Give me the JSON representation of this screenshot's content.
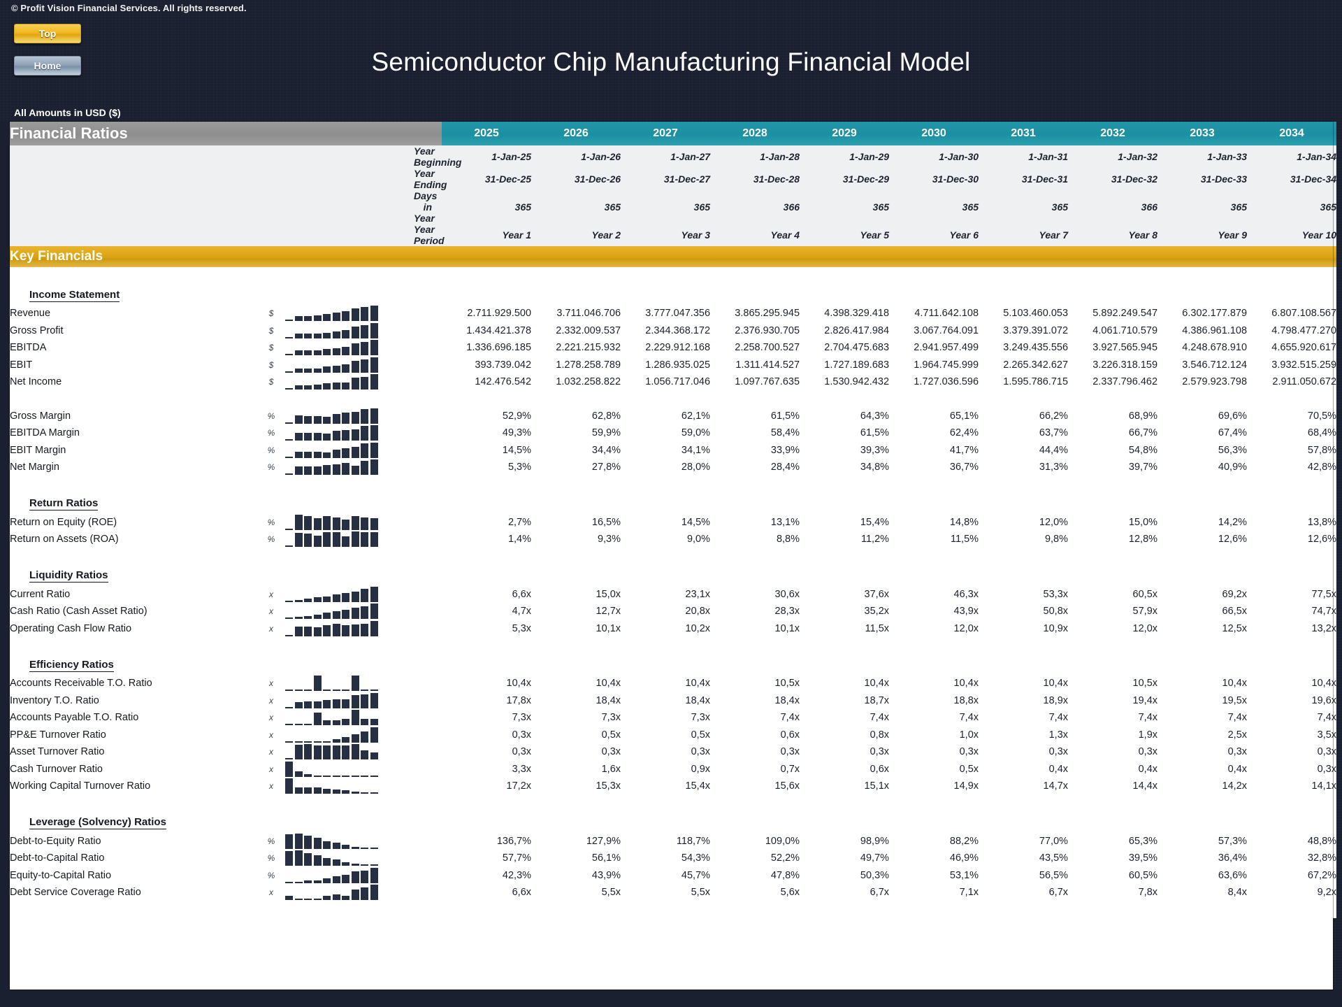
{
  "topbar": {
    "copyright": "© Profit Vision Financial Services. All rights reserved.",
    "top_button": "Top",
    "home_button": "Home"
  },
  "header": {
    "title": "Semiconductor Chip Manufacturing Financial Model",
    "units_note": "All Amounts in  USD ($)"
  },
  "table": {
    "title": "Financial Ratios",
    "section_banner": "Key Financials",
    "years": [
      "2025",
      "2026",
      "2027",
      "2028",
      "2029",
      "2030",
      "2031",
      "2032",
      "2033",
      "2034"
    ],
    "meta_rows": [
      {
        "label": "Year Beginning",
        "values": [
          "1-Jan-25",
          "1-Jan-26",
          "1-Jan-27",
          "1-Jan-28",
          "1-Jan-29",
          "1-Jan-30",
          "1-Jan-31",
          "1-Jan-32",
          "1-Jan-33",
          "1-Jan-34"
        ]
      },
      {
        "label": "Year Ending",
        "values": [
          "31-Dec-25",
          "31-Dec-26",
          "31-Dec-27",
          "31-Dec-28",
          "31-Dec-29",
          "31-Dec-30",
          "31-Dec-31",
          "31-Dec-32",
          "31-Dec-33",
          "31-Dec-34"
        ]
      },
      {
        "label": "Days in Year",
        "values": [
          "365",
          "365",
          "365",
          "366",
          "365",
          "365",
          "365",
          "366",
          "365",
          "365"
        ]
      },
      {
        "label": "Year Period",
        "values": [
          "Year 1",
          "Year 2",
          "Year 3",
          "Year 4",
          "Year 5",
          "Year 6",
          "Year 7",
          "Year 8",
          "Year 9",
          "Year 10"
        ]
      }
    ],
    "sections": [
      {
        "name": "Income Statement",
        "rows": [
          {
            "label": "Revenue",
            "unit": "$",
            "spark": [
              2,
              11,
              11,
              13,
              16,
              20,
              23,
              30,
              33,
              36
            ],
            "values": [
              "2.711.929.500",
              "3.711.046.706",
              "3.777.047.356",
              "3.865.295.945",
              "4.398.329.418",
              "4.711.642.108",
              "5.103.460.053",
              "5.892.249.547",
              "6.302.177.879",
              "6.807.108.567"
            ]
          },
          {
            "label": "Gross Profit",
            "unit": "$",
            "spark": [
              2,
              11,
              11,
              11,
              13,
              16,
              20,
              28,
              31,
              36
            ],
            "values": [
              "1.434.421.378",
              "2.332.009.537",
              "2.344.368.172",
              "2.376.930.705",
              "2.826.417.984",
              "3.067.764.091",
              "3.379.391.072",
              "4.061.710.579",
              "4.386.961.108",
              "4.798.477.270"
            ]
          },
          {
            "label": "EBITDA",
            "unit": "$",
            "spark": [
              2,
              11,
              11,
              11,
              14,
              16,
              20,
              28,
              31,
              36
            ],
            "values": [
              "1.336.696.185",
              "2.221.215.932",
              "2.229.912.168",
              "2.258.700.527",
              "2.704.475.683",
              "2.941.957.499",
              "3.249.435.556",
              "3.927.565.945",
              "4.248.678.910",
              "4.655.920.617"
            ]
          },
          {
            "label": "EBIT",
            "unit": "$",
            "spark": [
              2,
              9,
              9,
              10,
              14,
              16,
              19,
              28,
              31,
              36
            ],
            "values": [
              "393.739.042",
              "1.278.258.789",
              "1.286.935.025",
              "1.311.414.527",
              "1.727.189.683",
              "1.964.745.999",
              "2.265.342.627",
              "3.226.318.159",
              "3.546.712.124",
              "3.932.515.259"
            ]
          },
          {
            "label": "Net Income",
            "unit": "$",
            "spark": [
              2,
              10,
              10,
              11,
              15,
              17,
              16,
              27,
              30,
              36
            ],
            "values": [
              "142.476.542",
              "1.032.258.822",
              "1.056.717.046",
              "1.097.767.635",
              "1.530.942.432",
              "1.727.036.596",
              "1.595.786.715",
              "2.337.796.462",
              "2.579.923.798",
              "2.911.050.672"
            ]
          }
        ]
      },
      {
        "name": "",
        "rows": [
          {
            "label": "Gross Margin",
            "unit": "%",
            "spark": [
              2,
              18,
              17,
              17,
              16,
              22,
              24,
              26,
              32,
              34
            ],
            "values": [
              "52,9%",
              "62,8%",
              "62,1%",
              "61,5%",
              "64,3%",
              "65,1%",
              "66,2%",
              "68,9%",
              "69,6%",
              "70,5%"
            ]
          },
          {
            "label": "EBITDA Margin",
            "unit": "%",
            "spark": [
              2,
              17,
              17,
              17,
              16,
              21,
              23,
              25,
              32,
              34
            ],
            "values": [
              "49,3%",
              "59,9%",
              "59,0%",
              "58,4%",
              "61,5%",
              "62,4%",
              "63,7%",
              "66,7%",
              "67,4%",
              "68,4%"
            ]
          },
          {
            "label": "EBIT Margin",
            "unit": "%",
            "spark": [
              2,
              14,
              14,
              14,
              13,
              19,
              22,
              24,
              32,
              34
            ],
            "values": [
              "14,5%",
              "34,4%",
              "34,1%",
              "33,9%",
              "39,3%",
              "41,7%",
              "44,4%",
              "54,8%",
              "56,3%",
              "57,8%"
            ]
          },
          {
            "label": "Net Margin",
            "unit": "%",
            "spark": [
              2,
              17,
              17,
              17,
              21,
              22,
              25,
              19,
              29,
              32
            ],
            "values": [
              "5,3%",
              "27,8%",
              "28,0%",
              "28,4%",
              "34,8%",
              "36,7%",
              "31,3%",
              "39,7%",
              "40,9%",
              "42,8%"
            ]
          }
        ]
      },
      {
        "name": "Return Ratios",
        "rows": [
          {
            "label": "Return on Equity (ROE)",
            "unit": "%",
            "spark": [
              2,
              24,
              22,
              18,
              22,
              20,
              16,
              22,
              20,
              19
            ],
            "values": [
              "2,7%",
              "16,5%",
              "14,5%",
              "13,1%",
              "15,4%",
              "14,8%",
              "12,0%",
              "15,0%",
              "14,2%",
              "13,8%"
            ]
          },
          {
            "label": "Return on Assets (ROA)",
            "unit": "%",
            "spark": [
              2,
              20,
              19,
              16,
              21,
              21,
              15,
              22,
              21,
              21
            ],
            "values": [
              "1,4%",
              "9,3%",
              "9,0%",
              "8,8%",
              "11,2%",
              "11,5%",
              "9,8%",
              "12,8%",
              "12,6%",
              "12,6%"
            ]
          }
        ]
      },
      {
        "name": "Liquidity Ratios",
        "rows": [
          {
            "label": "Current Ratio",
            "unit": "x",
            "spark": [
              2,
              4,
              6,
              8,
              10,
              13,
              16,
              19,
              23,
              27
            ],
            "values": [
              "6,6x",
              "15,0x",
              "23,1x",
              "30,6x",
              "37,6x",
              "46,3x",
              "53,3x",
              "60,5x",
              "69,2x",
              "77,5x"
            ]
          },
          {
            "label": "Cash Ratio (Cash Asset Ratio)",
            "unit": "x",
            "spark": [
              2,
              3,
              5,
              7,
              10,
              12,
              15,
              18,
              21,
              25
            ],
            "values": [
              "4,7x",
              "12,7x",
              "20,8x",
              "28,3x",
              "35,2x",
              "43,9x",
              "50,8x",
              "57,9x",
              "66,5x",
              "74,7x"
            ]
          },
          {
            "label": "Operating Cash Flow Ratio",
            "unit": "x",
            "spark": [
              2,
              14,
              14,
              13,
              16,
              18,
              16,
              17,
              18,
              22
            ],
            "values": [
              "5,3x",
              "10,1x",
              "10,2x",
              "10,1x",
              "11,5x",
              "12,0x",
              "10,9x",
              "12,0x",
              "12,5x",
              "13,2x"
            ]
          }
        ]
      },
      {
        "name": "Efficiency Ratios",
        "rows": [
          {
            "label": "Accounts Receivable T.O. Ratio",
            "unit": "x",
            "spark": [
              2,
              2,
              2,
              22,
              2,
              2,
              2,
              22,
              2,
              2
            ],
            "values": [
              "10,4x",
              "10,4x",
              "10,4x",
              "10,5x",
              "10,4x",
              "10,4x",
              "10,4x",
              "10,5x",
              "10,4x",
              "10,4x"
            ]
          },
          {
            "label": "Inventory T.O. Ratio",
            "unit": "x",
            "spark": [
              2,
              11,
              12,
              12,
              14,
              15,
              15,
              22,
              24,
              26
            ],
            "values": [
              "17,8x",
              "18,4x",
              "18,4x",
              "18,4x",
              "18,7x",
              "18,8x",
              "18,9x",
              "19,4x",
              "19,5x",
              "19,6x"
            ]
          },
          {
            "label": "Accounts Payable T.O. Ratio",
            "unit": "x",
            "spark": [
              2,
              2,
              2,
              16,
              6,
              6,
              8,
              20,
              8,
              8
            ],
            "values": [
              "7,3x",
              "7,3x",
              "7,3x",
              "7,4x",
              "7,4x",
              "7,4x",
              "7,4x",
              "7,4x",
              "7,4x",
              "7,4x"
            ]
          },
          {
            "label": "PP&E Turnover Ratio",
            "unit": "x",
            "spark": [
              2,
              2,
              2,
              2,
              2,
              5,
              9,
              13,
              17,
              24
            ],
            "values": [
              "0,3x",
              "0,5x",
              "0,5x",
              "0,6x",
              "0,8x",
              "1,0x",
              "1,3x",
              "1,9x",
              "2,5x",
              "3,5x"
            ]
          },
          {
            "label": "Asset Turnover Ratio",
            "unit": "x",
            "spark": [
              2,
              17,
              18,
              16,
              16,
              16,
              16,
              18,
              11,
              8
            ],
            "values": [
              "0,3x",
              "0,3x",
              "0,3x",
              "0,3x",
              "0,3x",
              "0,3x",
              "0,3x",
              "0,3x",
              "0,3x",
              "0,3x"
            ]
          },
          {
            "label": "Cash Turnover Ratio",
            "unit": "x",
            "spark": [
              20,
              7,
              4,
              2,
              2,
              2,
              2,
              2,
              2,
              2
            ],
            "values": [
              "3,3x",
              "1,6x",
              "0,9x",
              "0,7x",
              "0,6x",
              "0,5x",
              "0,4x",
              "0,4x",
              "0,4x",
              "0,3x"
            ]
          },
          {
            "label": "Working Capital Turnover Ratio",
            "unit": "x",
            "spark": [
              21,
              9,
              9,
              9,
              7,
              6,
              5,
              3,
              2,
              2
            ],
            "values": [
              "17,2x",
              "15,3x",
              "15,4x",
              "15,6x",
              "15,1x",
              "14,9x",
              "14,7x",
              "14,4x",
              "14,2x",
              "14,1x"
            ]
          }
        ]
      },
      {
        "name": "Leverage (Solvency) Ratios",
        "rows": [
          {
            "label": "Debt-to-Equity Ratio",
            "unit": "%",
            "spark": [
              22,
              23,
              20,
              17,
              12,
              9,
              6,
              3,
              2,
              2
            ],
            "values": [
              "136,7%",
              "127,9%",
              "118,7%",
              "109,0%",
              "98,9%",
              "88,2%",
              "77,0%",
              "65,3%",
              "57,3%",
              "48,8%"
            ]
          },
          {
            "label": "Debt-to-Capital Ratio",
            "unit": "%",
            "spark": [
              22,
              23,
              19,
              16,
              12,
              9,
              5,
              3,
              2,
              2
            ],
            "values": [
              "57,7%",
              "56,1%",
              "54,3%",
              "52,2%",
              "49,7%",
              "46,9%",
              "43,5%",
              "39,5%",
              "36,4%",
              "32,8%"
            ]
          },
          {
            "label": "Equity-to-Capital Ratio",
            "unit": "%",
            "spark": [
              2,
              2,
              4,
              5,
              8,
              11,
              14,
              19,
              21,
              25
            ],
            "values": [
              "42,3%",
              "43,9%",
              "45,7%",
              "47,8%",
              "50,3%",
              "53,1%",
              "56,5%",
              "60,5%",
              "63,6%",
              "67,2%"
            ]
          },
          {
            "label": "Debt Service Coverage Ratio",
            "unit": "x",
            "spark": [
              6,
              2,
              2,
              2,
              6,
              9,
              7,
              16,
              20,
              24
            ],
            "values": [
              "6,6x",
              "5,5x",
              "5,5x",
              "5,6x",
              "6,7x",
              "7,1x",
              "6,7x",
              "7,8x",
              "8,4x",
              "9,2x"
            ]
          }
        ]
      }
    ]
  },
  "colors": {
    "accent_teal": "#1c8fa1",
    "accent_gold": "#dca412",
    "band_gray": "#8e8e8e",
    "background": "#1b2030",
    "spark_bar": "#273043"
  }
}
